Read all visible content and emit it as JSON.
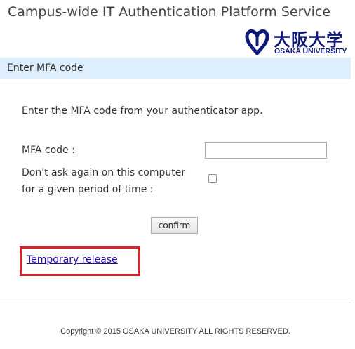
{
  "header": {
    "title": "Campus-wide IT Authentication Platform Service",
    "logo": {
      "name_ja": "大阪大学",
      "name_en": "OSAKA UNIVERSITY",
      "icon": "osaka-university-emblem",
      "color": "#101a7a"
    }
  },
  "section": {
    "title": "Enter MFA code",
    "background": "#ddeefc"
  },
  "form": {
    "instructions": "Enter the MFA code from your authenticator app.",
    "mfa_label": "MFA code :",
    "mfa_value": "",
    "remember_label_line1": "Don't ask again on this computer",
    "remember_label_line2": "for a given period of time :",
    "remember_checked": false,
    "confirm_label": "confirm"
  },
  "temporary_release": {
    "label": "Temporary release",
    "highlight_color": "#e0202a"
  },
  "footer": {
    "copyright": "Copyright © 2015 OSAKA UNIVERSITY ALL RIGHTS RESERVED."
  }
}
